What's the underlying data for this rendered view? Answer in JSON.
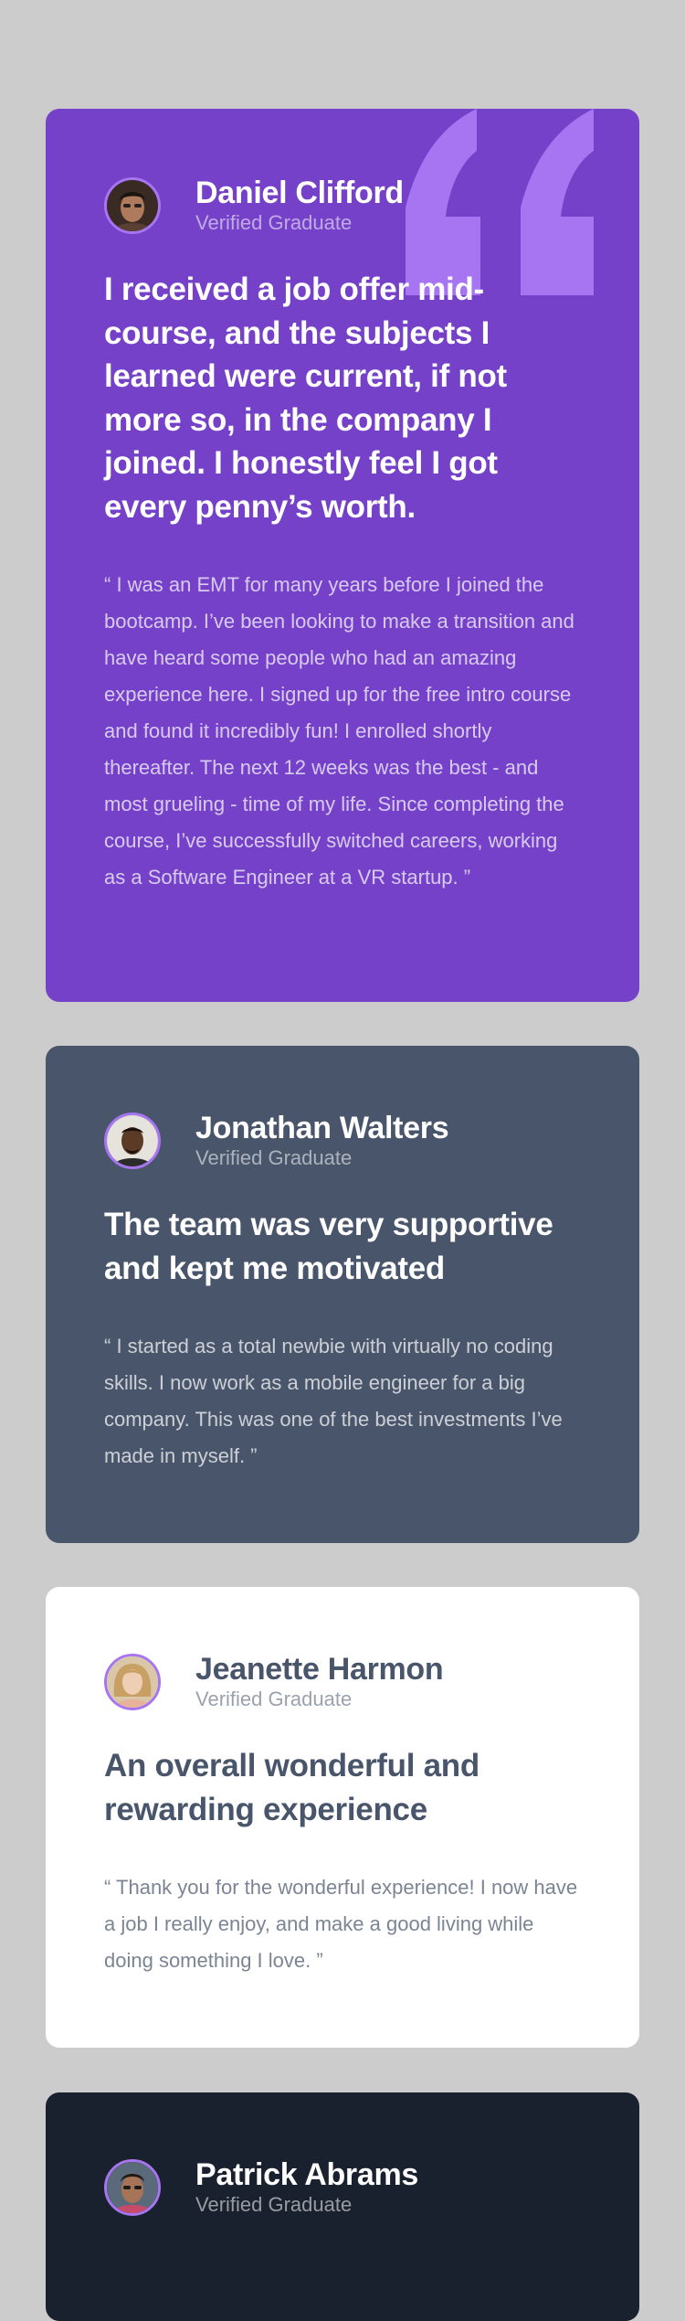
{
  "colors": {
    "page_background": "#cccccc",
    "card_purple": "#7541c8",
    "card_slate": "#48556a",
    "card_white": "#ffffff",
    "card_dark": "#19212e",
    "quote_mark": "#a775f1"
  },
  "testimonials": [
    {
      "name": "Daniel Clifford",
      "role": "Verified Graduate",
      "headline": "I received a job offer mid-course, and the subjects I learned were current, if not more so, in the company I joined. I honestly feel I got every penny’s worth.",
      "quote": "“ I was an EMT for many years before I joined the bootcamp. I’ve been looking to make a transition and have heard some people who had an amazing experience here. I signed up for the free intro course and found it incredibly fun! I enrolled shortly thereafter. The next 12 weeks was the best - and most grueling - time of my life. Since completing the course, I’ve successfully switched careers, working as a Software Engineer at a VR startup. ”"
    },
    {
      "name": "Jonathan Walters",
      "role": "Verified Graduate",
      "headline": "The team was very supportive and kept me motivated",
      "quote": "“ I started as a total newbie with virtually no coding skills. I now work as a mobile engineer for a big company. This was one of the best investments I’ve made in myself. ”"
    },
    {
      "name": "Jeanette Harmon",
      "role": "Verified Graduate",
      "headline": "An overall wonderful and rewarding experience",
      "quote": "“ Thank you for the wonderful experience! I now have a job I really enjoy, and make a good living while doing something I love. ”"
    },
    {
      "name": "Patrick Abrams",
      "role": "Verified Graduate"
    }
  ]
}
